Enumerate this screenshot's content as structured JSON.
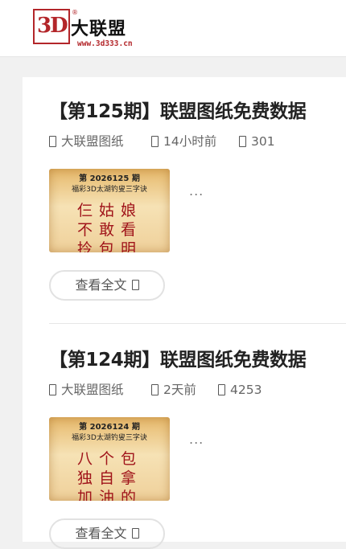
{
  "header": {
    "logo_mark": "3D",
    "logo_text": "大联盟",
    "logo_reg": "®",
    "logo_url": "www.3d333.cn"
  },
  "posts": [
    {
      "title": "【第125期】联盟图纸免费数据",
      "category": "大联盟图纸",
      "time": "14小时前",
      "views": "301",
      "thumb": {
        "issue": "第 2026125 期",
        "subtitle": "福彩3D太湖钓叟三字诀",
        "lines": [
          "仨姑娘",
          "不敢看",
          "拎包明"
        ]
      },
      "excerpt": "...",
      "read_more": "查看全文"
    },
    {
      "title": "【第124期】联盟图纸免费数据",
      "category": "大联盟图纸",
      "time": "2天前",
      "views": "4253",
      "thumb": {
        "issue": "第 2026124 期",
        "subtitle": "福彩3D太湖钓叟三字诀",
        "lines": [
          "八个包",
          "独自拿",
          "加油的"
        ]
      },
      "excerpt": "...",
      "read_more": "查看全文"
    }
  ],
  "icons": {
    "category": "folder-icon",
    "time": "clock-icon",
    "views": "eye-icon",
    "read_more": "arrow-right-icon"
  },
  "colors": {
    "brand_red": "#b3262a",
    "poem_red": "#a0141a"
  }
}
